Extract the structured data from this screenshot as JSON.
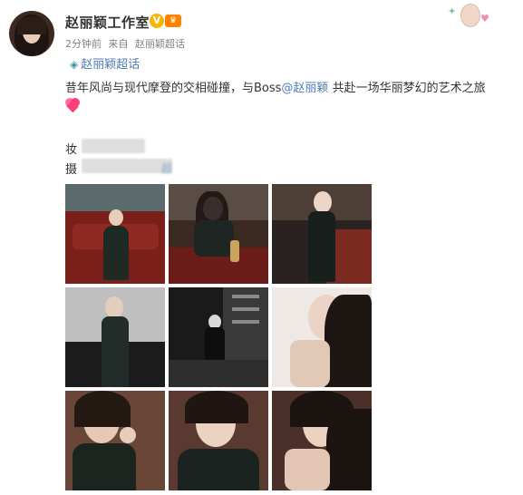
{
  "post": {
    "username": "赵丽颖工作室",
    "verified_badge": "V",
    "vip_badge": "♛",
    "time": "2分钟前",
    "source_prefix": "来自",
    "source": "赵丽颖超话",
    "topic_label": "赵丽颖超话",
    "text_before": "昔年风尚与现代摩登的交相碰撞，与Boss",
    "mention": "@赵丽颖",
    "text_after": " 共赴一场华丽梦幻的艺术之旅",
    "credit_makeup_label": "妆",
    "credit_photo_label": "摄",
    "credit_photo_partial": "超"
  },
  "icons": {
    "avatar": "avatar-portrait",
    "topic": "supertopic-diamond-icon",
    "heart": "double-heart-emoji-icon",
    "sticker": "decorative-sticker-icon"
  },
  "colors": {
    "link": "#4d7bb7",
    "meta": "#808080",
    "verified": "#f7b500"
  },
  "photos": [
    {
      "desc": "woman-on-red-sofa"
    },
    {
      "desc": "woman-at-bar-hourglass"
    },
    {
      "desc": "woman-leaning-on-bar"
    },
    {
      "desc": "woman-dark-dress-piano"
    },
    {
      "desc": "woman-bar-monochrome"
    },
    {
      "desc": "woman-profile-hair"
    },
    {
      "desc": "woman-closeup-ring"
    },
    {
      "desc": "woman-lying-portrait"
    },
    {
      "desc": "woman-closeup-hand-ear"
    }
  ]
}
